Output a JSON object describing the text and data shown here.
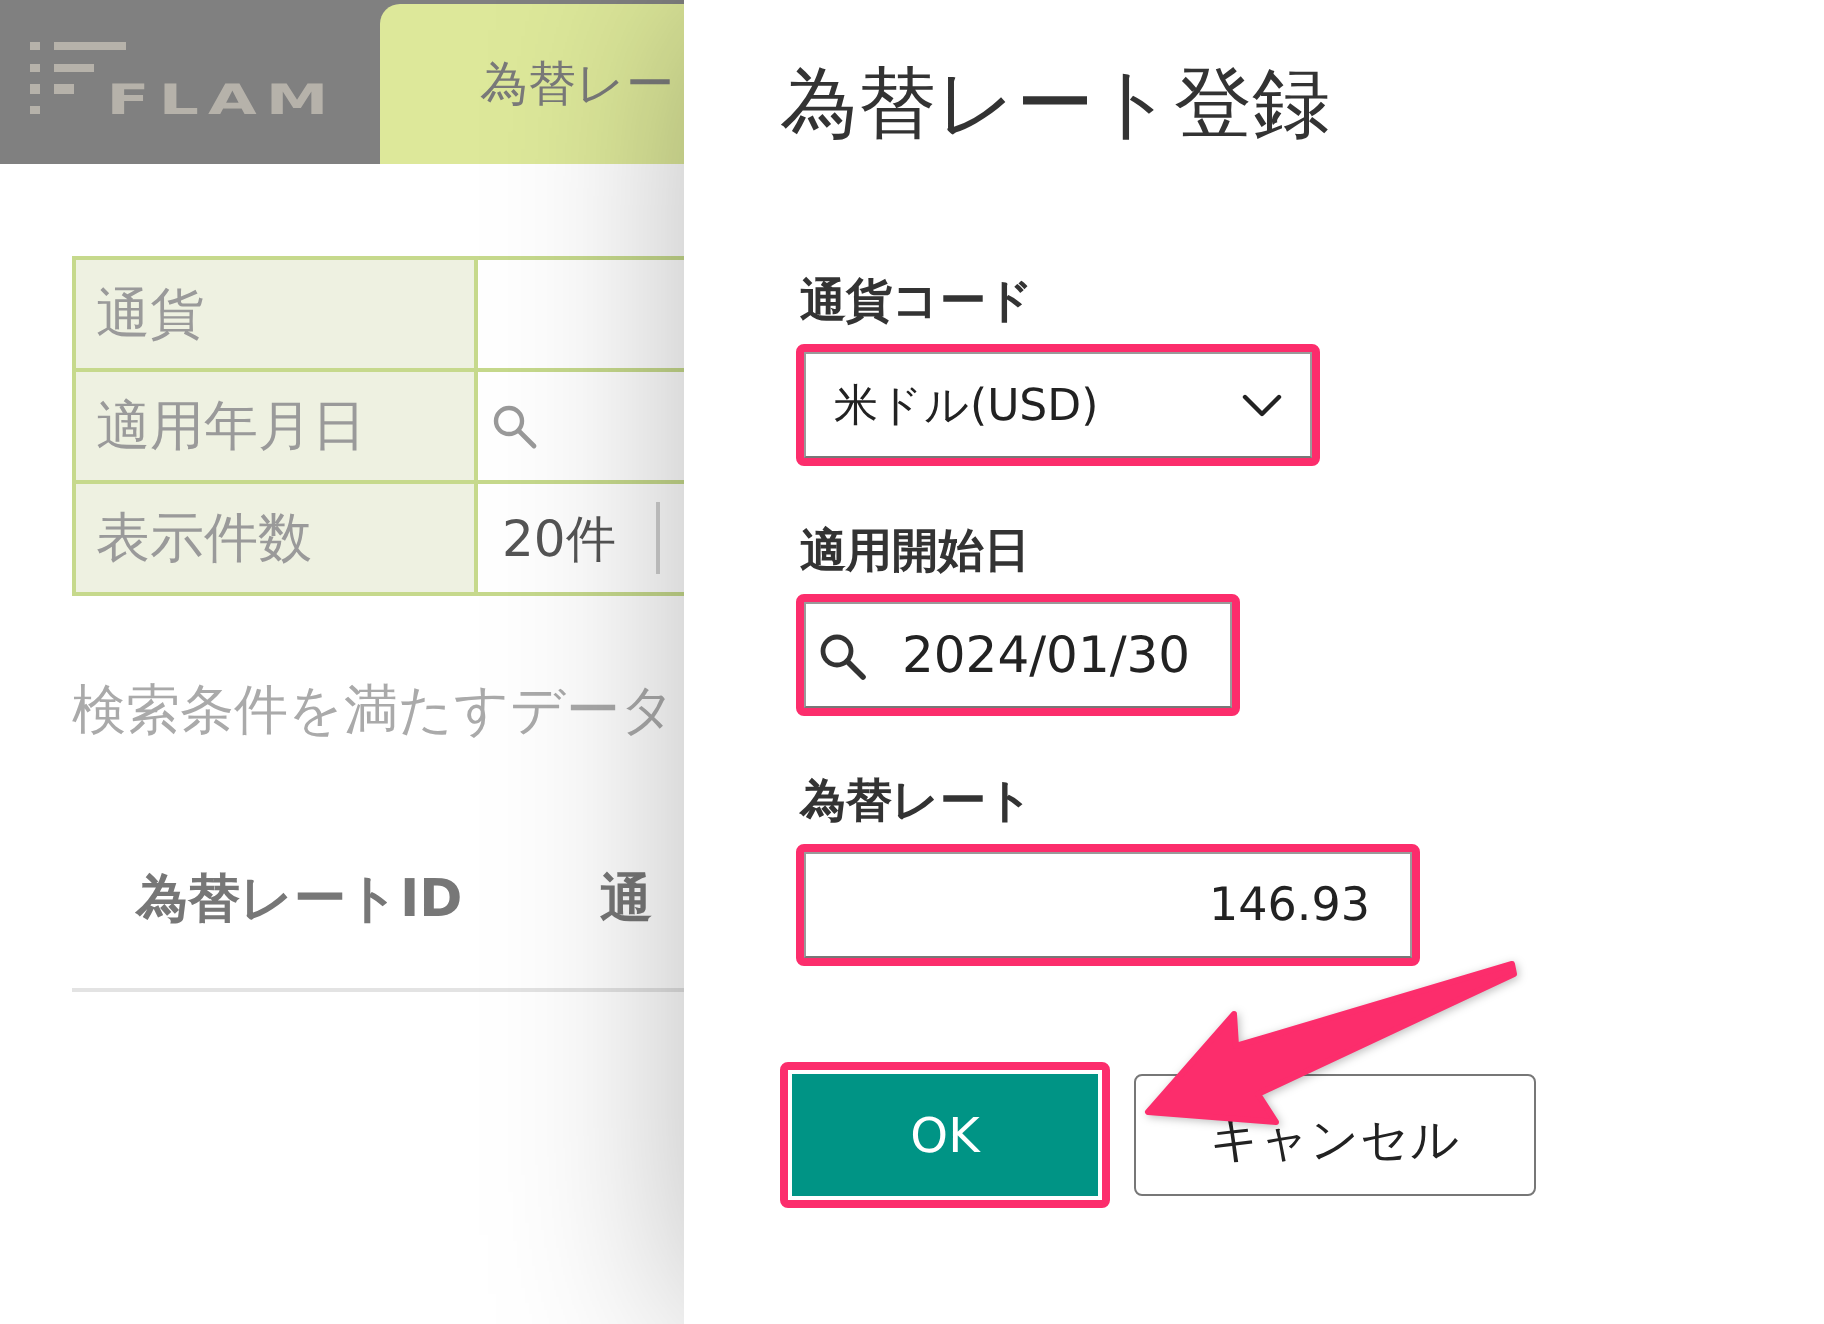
{
  "header": {
    "logo": "FLAM",
    "tabs": [
      {
        "label": "為替レー",
        "selected": true
      }
    ]
  },
  "filter_table": {
    "rows": [
      {
        "label": "通貨",
        "kind": "blank"
      },
      {
        "label": "適用年月日",
        "kind": "search"
      },
      {
        "label": "表示件数",
        "kind": "select",
        "value": "20件"
      }
    ]
  },
  "result_message": "検索条件を満たすデータ",
  "table": {
    "columns": [
      "為替レートID",
      "通"
    ]
  },
  "dialog": {
    "title": "為替レート登録",
    "fields": [
      {
        "kind": "select",
        "label": "通貨コード",
        "value": "米ドル(USD)",
        "highlighted": true
      },
      {
        "kind": "date",
        "label": "適用開始日",
        "value": "2024/01/30",
        "highlighted": true
      },
      {
        "kind": "number",
        "label": "為替レート",
        "value": "146.93",
        "highlighted": true
      }
    ],
    "buttons": [
      {
        "kind": "primary",
        "label": "OK",
        "highlighted": true
      },
      {
        "kind": "secondary",
        "label": "キャンセル",
        "highlighted": false
      }
    ],
    "pointer_arrow": true
  }
}
